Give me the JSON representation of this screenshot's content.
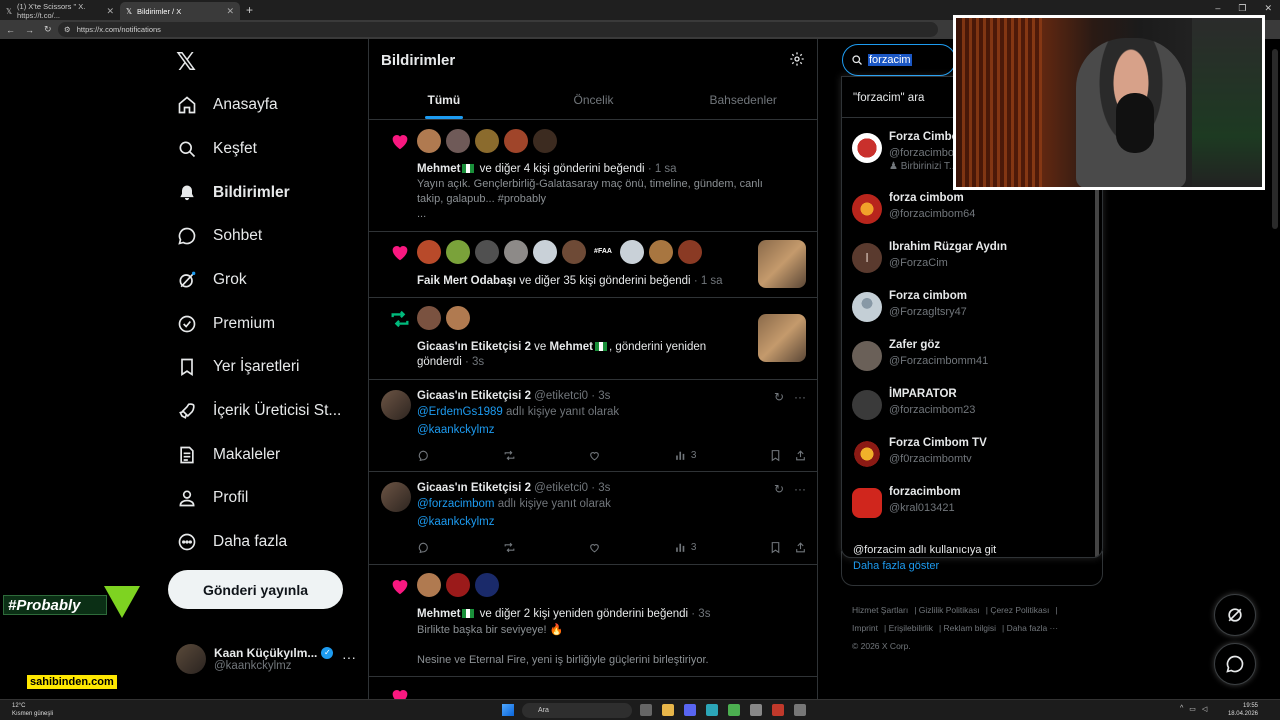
{
  "browser": {
    "tabs": [
      {
        "label": "(1) X'te Scissors \" X. https://t.co/...",
        "active": false
      },
      {
        "label": "Bildirimler / X",
        "active": true
      }
    ],
    "url": "https://x.com/notifications"
  },
  "nav": {
    "items": [
      {
        "label": "Anasayfa",
        "icon": "home-icon"
      },
      {
        "label": "Keşfet",
        "icon": "search-icon"
      },
      {
        "label": "Bildirimler",
        "icon": "bell-icon",
        "active": true
      },
      {
        "label": "Sohbet",
        "icon": "chat-icon"
      },
      {
        "label": "Grok",
        "icon": "grok-icon"
      },
      {
        "label": "Premium",
        "icon": "premium-icon"
      },
      {
        "label": "Yer İşaretleri",
        "icon": "bookmark-icon"
      },
      {
        "label": "İçerik Üreticisi St...",
        "icon": "rocket-icon"
      },
      {
        "label": "Makaleler",
        "icon": "article-icon"
      },
      {
        "label": "Profil",
        "icon": "person-icon"
      },
      {
        "label": "Daha fazla",
        "icon": "more-circle-icon"
      }
    ],
    "post_button": "Gönderi yayınla",
    "account": {
      "name": "Kaan Küçükyılm...",
      "handle": "@kaankckylmz"
    }
  },
  "overlays": {
    "probably": "#Probably",
    "sahibinden": "sahibinden.com"
  },
  "main": {
    "title": "Bildirimler",
    "tabs": [
      "Tümü",
      "Öncelik",
      "Bahsedenler"
    ],
    "notifications": [
      {
        "type": "like",
        "actor": "Mehmet",
        "rest": "ve diğer 4 kişi gönderini beğendi",
        "time": "· 1 sa",
        "body": "Yayın açık. Gençlerbirliğ-Galatasaray maç önü, timeline, gündem, canlı takip, galapub... #probably",
        "ellipsis": "..."
      },
      {
        "type": "like",
        "actor": "Faik Mert Odabaşı",
        "rest": "ve diğer 35 kişi gönderini beğendi",
        "time": "· 1 sa",
        "fam_label": "#FAA"
      },
      {
        "type": "repost",
        "actor": "Gicaas'ın Etiketçisi 2",
        "and": "ve",
        "actor2": "Mehmet",
        "rest": ", gönderini yeniden gönderdi",
        "time": "· 3s"
      },
      {
        "type": "like",
        "actor": "Mehmet",
        "rest": "ve diğer 2 kişi yeniden gönderini beğendi",
        "time": "· 3s",
        "body1": "Birlikte başka bir seviyeye! 🔥",
        "body2": "Nesine ve Eternal Fire, yeni iş birliğiyle güçlerini birleştiriyor."
      }
    ],
    "replies": [
      {
        "name": "Gicaas'ın Etiketçisi 2",
        "handle": "@etiketci0",
        "time": "· 3s",
        "reply_to": "@ErdemGs1989",
        "reply_suffix": "adlı kişiye yanıt olarak",
        "text": "@kaankckylmz",
        "views": "3"
      },
      {
        "name": "Gicaas'ın Etiketçisi 2",
        "handle": "@etiketci0",
        "time": "· 3s",
        "reply_to": "@forzacimbom",
        "reply_suffix": "adlı kişiye yanıt olarak",
        "text": "@kaankckylmz",
        "views": "3"
      }
    ]
  },
  "search": {
    "value": "forzacim",
    "query_label": "\"forzacim\" ara",
    "results": [
      {
        "name": "Forza Cimbom",
        "handle": "@forzacimbom",
        "sub": "Birbirinizi T..."
      },
      {
        "name": "forza cimbom",
        "handle": "@forzacimbom64"
      },
      {
        "name": "Ibrahim Rüzgar Aydın",
        "handle": "@ForzaCim",
        "initial": "I"
      },
      {
        "name": "Forza cimbom",
        "handle": "@Forzagltsry47"
      },
      {
        "name": "Zafer göz",
        "handle": "@Forzacimbomm41"
      },
      {
        "name": "İMPARATOR",
        "handle": "@forzacimbom23"
      },
      {
        "name": "Forza Cimbom TV",
        "handle": "@f0rzacimbomtv"
      },
      {
        "name": "forzacimbom",
        "handle": "@kral013421"
      }
    ],
    "goto": "@forzacim adlı kullanıcıya git",
    "show_more": "Daha fazla göster"
  },
  "footer": {
    "links": [
      "Hizmet Şartları",
      "Gizlilik Politikası",
      "Çerez Politikası",
      "Imprint",
      "Erişilebilirlik",
      "Reklam bilgisi",
      "Daha fazla ···"
    ],
    "copyright": "© 2026 X Corp."
  },
  "taskbar": {
    "weather_temp": "12°C",
    "weather_desc": "Kısmen güneşli",
    "search": "Ara",
    "time": "19:55",
    "date": "18.04.2026"
  },
  "colors": {
    "accent": "#1d9bf0",
    "like": "#f91880",
    "repost": "#00ba7c"
  }
}
